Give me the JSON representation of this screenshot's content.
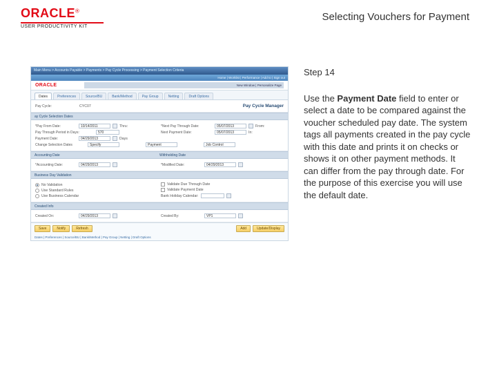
{
  "header": {
    "brand": "ORACLE",
    "productLine": "USER PRODUCTIVITY KIT",
    "pageTitle": "Selecting Vouchers for Payment"
  },
  "stepLabel": "Step 14",
  "instruction": {
    "prefix": "Use the ",
    "strong": "Payment Date",
    "suffix": " field to enter or select a date to be compared against the voucher scheduled pay date. The system tags all payments created in the pay cycle with this date and prints it on checks or shows it on other payment methods. It can differ from the pay through date. For the purpose of this exercise you will use the default date."
  },
  "app": {
    "breadcrumb": "Main Menu > Accounts Payable > Payments > Pay Cycle Processing > Payment Selection Criteria",
    "subLinks": "Home | Worklist | Performance | Add to | Sign out",
    "miniLogo": "ORACLE",
    "toolbarLinks": "New Window | Personalize Page",
    "tabs": [
      "Dates",
      "Preferences",
      "Source/BU",
      "Bank/Method",
      "Pay Group",
      "Netting",
      "Draft Options"
    ],
    "payCycleLabel": "Pay Cycle:",
    "payCycleValue": "CYC07",
    "managerLabel": "Pay Cycle Manager",
    "groupSelDates": "ay Cycle Selection Dates",
    "payFromLabel": "*Pay From Date:",
    "payFromValue": "10/14/2011",
    "thruLbl": "Thru:",
    "payThroughLabel": "*Next Pay Through Date:",
    "payThroughValue": "05/07/2013",
    "fromLbl": "From:",
    "payThroughPeriodLabel": "Pay Through Period in Days:",
    "payThroughPeriodValue": "570",
    "nextPayLabel": "Next Payment Date:",
    "nextPayValue": "05/07/2013",
    "inDaysLbl": "In:",
    "paymentDateLabel": "Payment Date:",
    "paymentDateValue": "04/29/2013",
    "daysLbl": "Days",
    "changeLabel": "Change Selection Dates",
    "specifyLabel": "Specify",
    "paymentLabel": "Payment",
    "jobControlLabel": "Job Control",
    "groupAcct": "Accounting Date",
    "groupWithhold": "Withholding Date",
    "acctDateLabel": "*Accounting Date:",
    "acctDateValue": "04/29/2013",
    "modDateLabel": "*Modified Date:",
    "modDateValue": "04/29/2013",
    "groupBDV": "Business Day Validation",
    "r1": "No Validation",
    "r2": "Use Standard Rules",
    "r3": "Use Business Calendar",
    "cbValidateThrough": "Validate Due Through Date",
    "cbValidatePayment": "Validate Payment Date",
    "holidayCalLabel": "Bank Holiday Calendar:",
    "groupCreated": "Created Info",
    "createdOnLabel": "Created On:",
    "createdOnValue": "04/29/2013",
    "createdByLabel": "Created By:",
    "createdByValue": "VP1",
    "btnSave": "Save",
    "btnNotify": "Notify",
    "btnRefresh": "Refresh",
    "btnAdd": "Add",
    "btnUpdate": "Update/Display",
    "trail": "Dates | Preferences | Source/BU | Bank/Method | Pay Group | Netting | Draft Options"
  }
}
